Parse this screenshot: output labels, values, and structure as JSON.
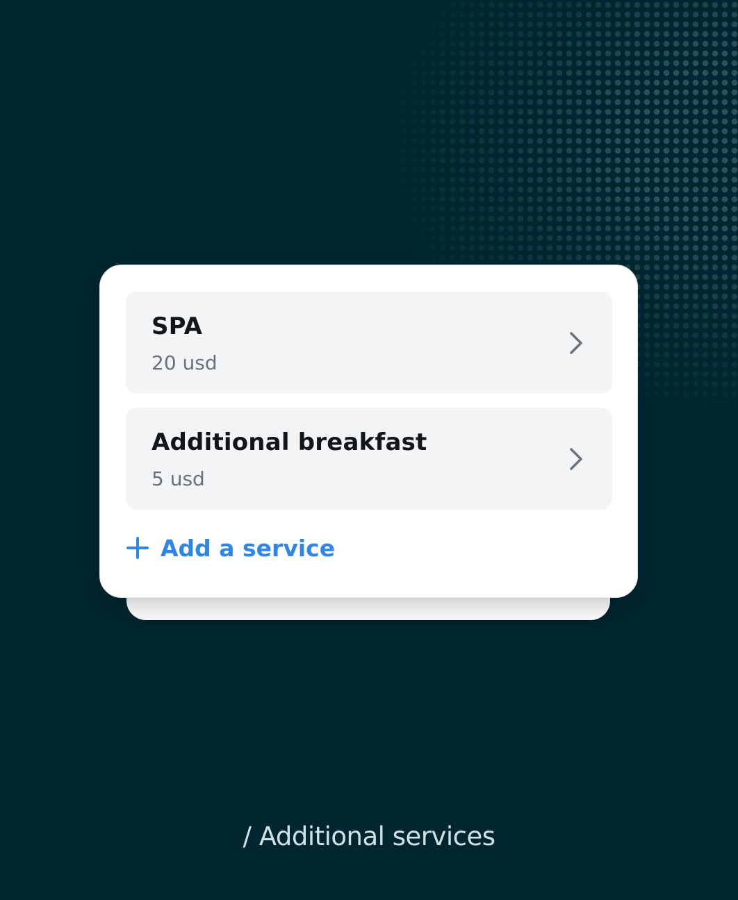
{
  "services": [
    {
      "name": "SPA",
      "price": "20 usd",
      "icon": "chevron-right-icon"
    },
    {
      "name": "Additional breakfast",
      "price": "5 usd",
      "icon": "chevron-right-icon"
    }
  ],
  "add_service": {
    "icon": "plus-icon",
    "label": "Add a service"
  },
  "caption": "/ Additional services",
  "colors": {
    "background": "#022630",
    "card": "#ffffff",
    "item_background": "#f3f4f6",
    "accent": "#2f86e8",
    "title_text": "#10171c",
    "secondary_text": "#6b7079",
    "caption_text": "#cfe3e6"
  }
}
